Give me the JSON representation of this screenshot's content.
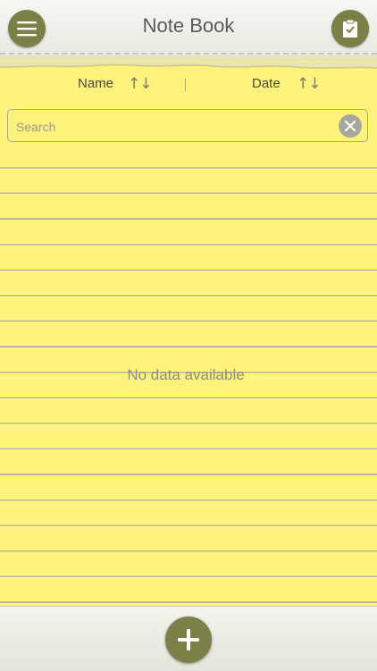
{
  "header": {
    "title": "Note Book",
    "menu_icon": "hamburger-menu-icon",
    "clipboard_icon": "clipboard-check-icon"
  },
  "sort": {
    "name_label": "Name",
    "date_label": "Date",
    "arrows": "↑↓"
  },
  "search": {
    "placeholder": "Search",
    "value": ""
  },
  "list": {
    "empty_message": "No data available"
  },
  "footer": {
    "add_icon": "plus-icon"
  },
  "colors": {
    "accent": "#7b8048",
    "paper": "#fff27d",
    "rule": "#b9b7a0"
  }
}
